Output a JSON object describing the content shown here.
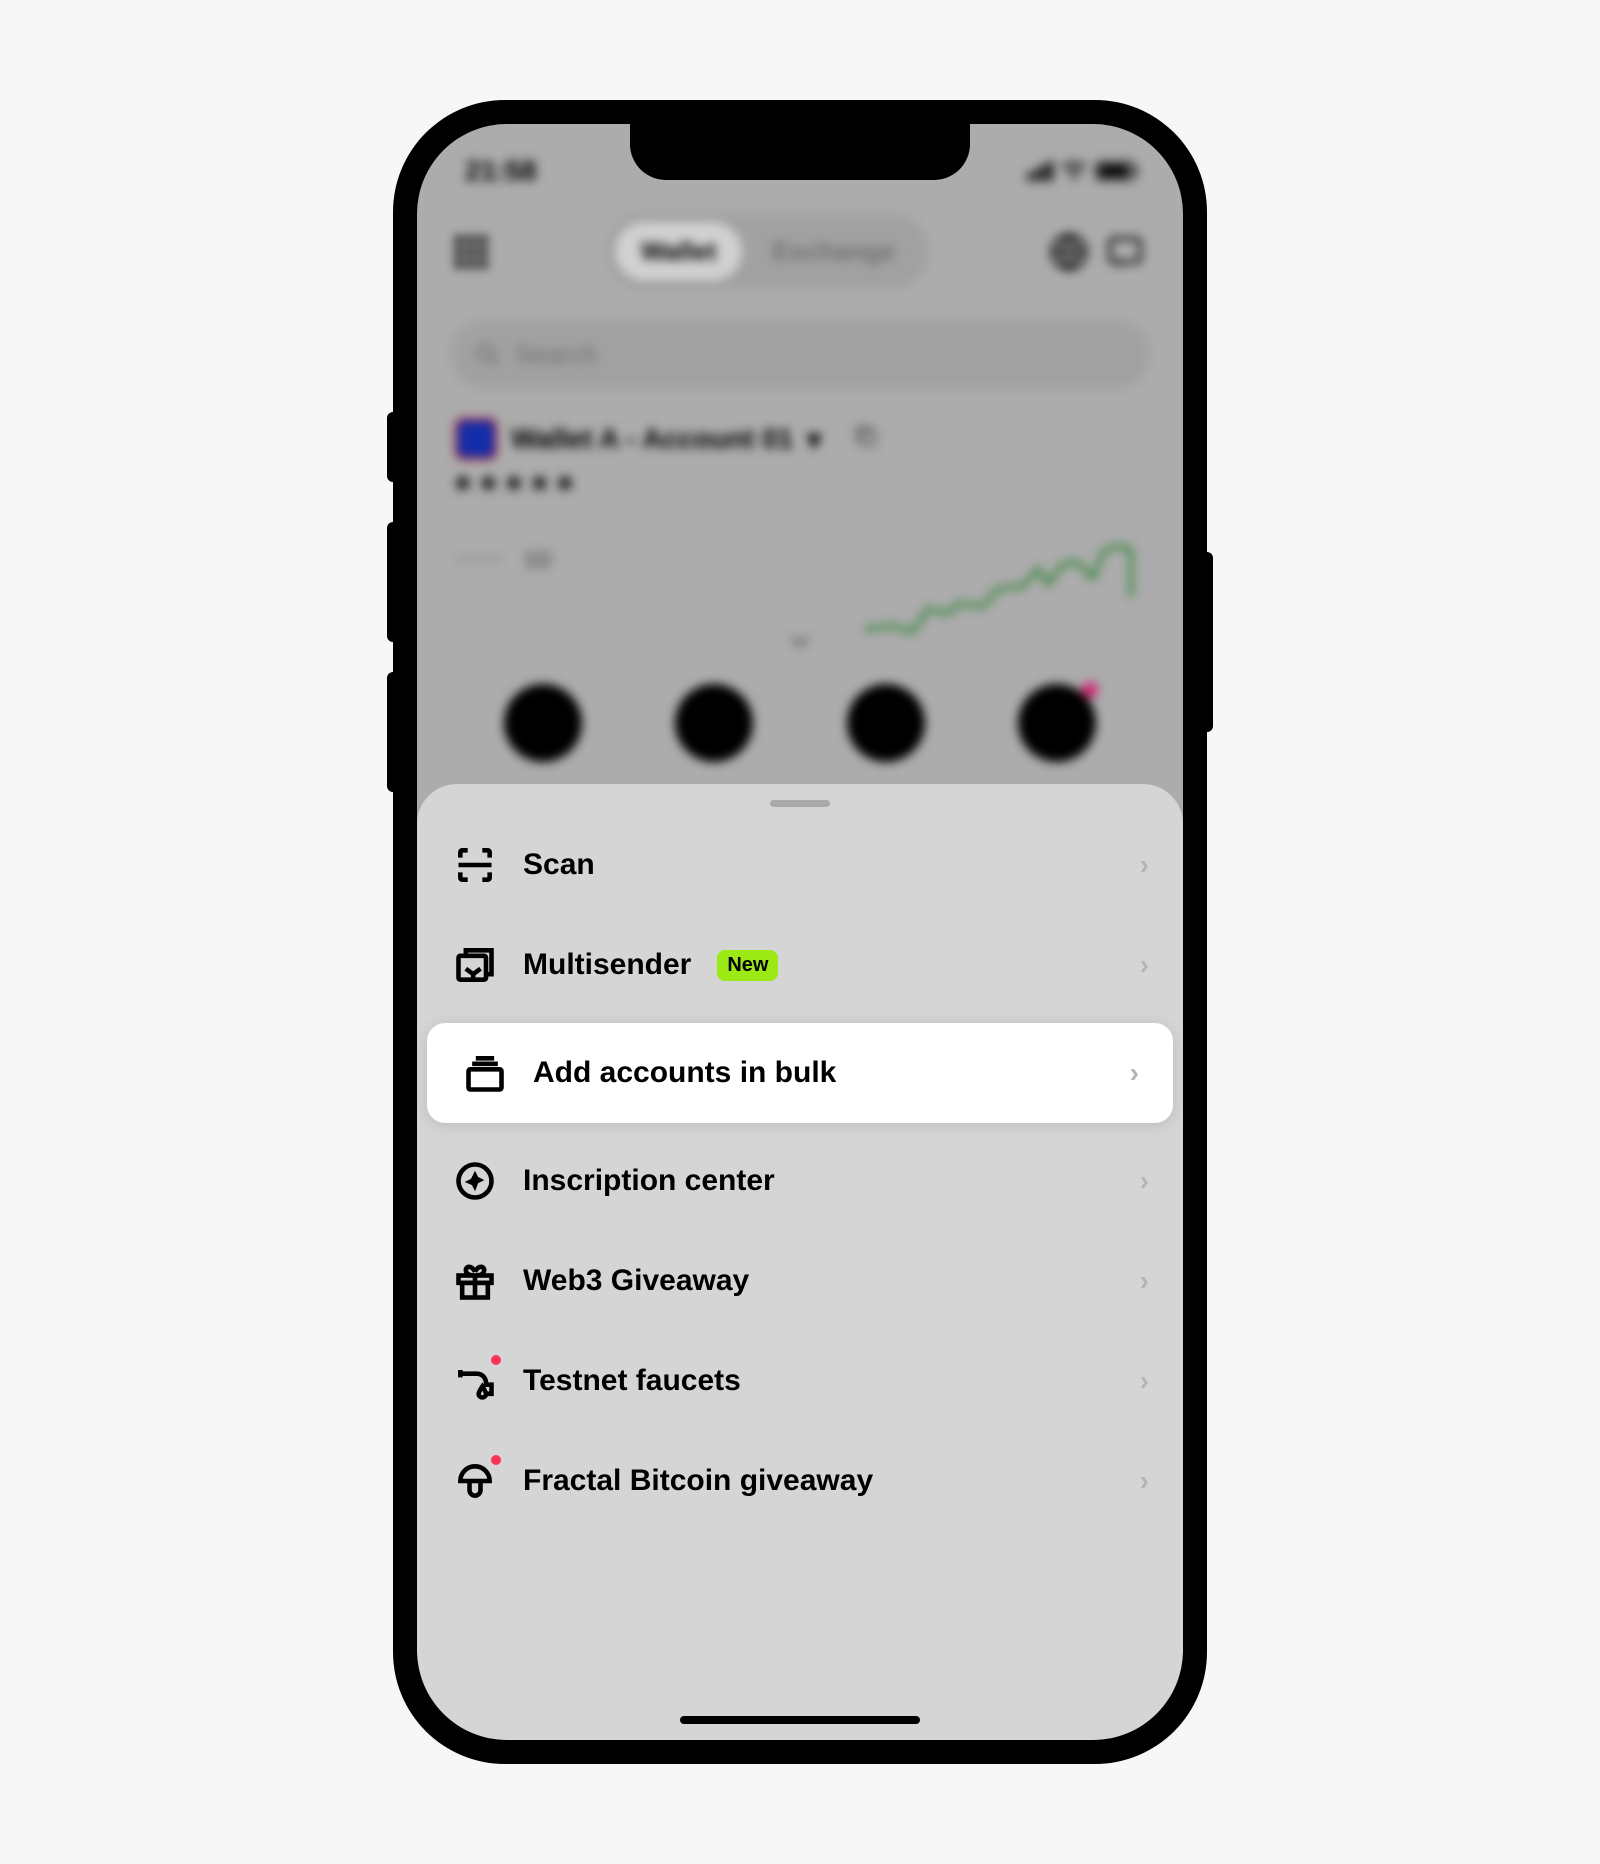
{
  "status": {
    "time": "21:58"
  },
  "tabs": {
    "wallet": "Wallet",
    "exchange": "Exchange"
  },
  "search": {
    "placeholder": "Search"
  },
  "account": {
    "label": "Wallet A - Account 01",
    "balance": "*****",
    "change": "·····",
    "period": "1D"
  },
  "sheet": {
    "items": [
      {
        "label": "Scan",
        "icon": "scan",
        "highlighted": false
      },
      {
        "label": "Multisender",
        "icon": "multisender",
        "badge": "New",
        "highlighted": false
      },
      {
        "label": "Add accounts in bulk",
        "icon": "stack",
        "highlighted": true
      },
      {
        "label": "Inscription center",
        "icon": "sparkle",
        "highlighted": false
      },
      {
        "label": "Web3 Giveaway",
        "icon": "gift",
        "highlighted": false
      },
      {
        "label": "Testnet faucets",
        "icon": "faucet",
        "dot": true,
        "highlighted": false
      },
      {
        "label": "Fractal Bitcoin giveaway",
        "icon": "mushroom",
        "dot": true,
        "highlighted": false
      }
    ]
  }
}
